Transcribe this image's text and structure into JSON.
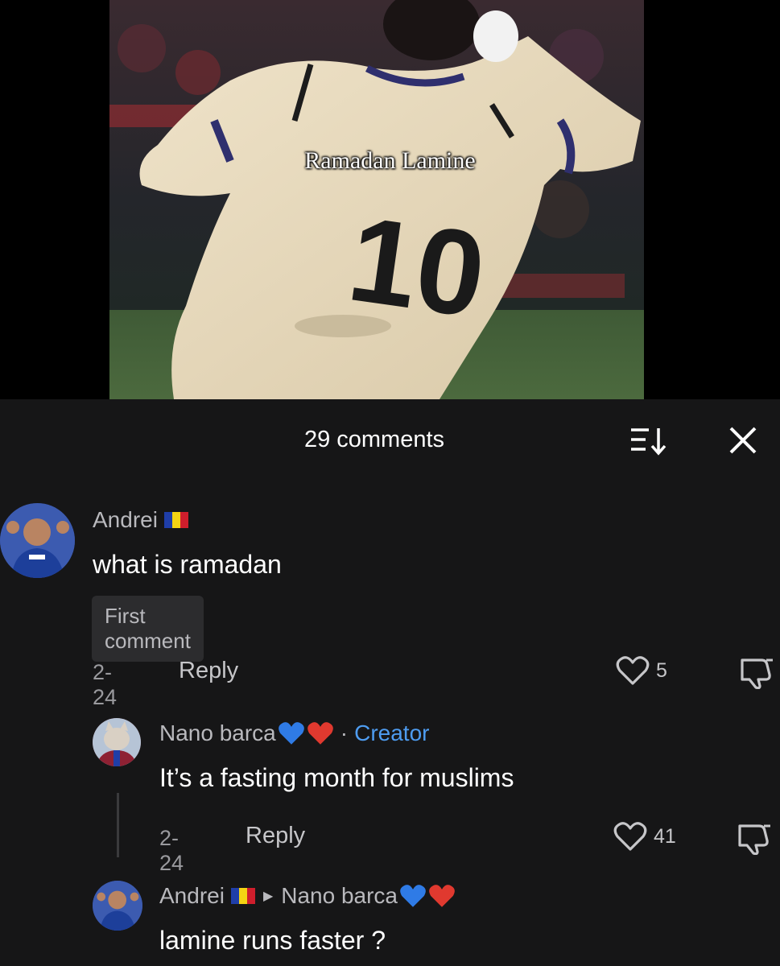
{
  "video": {
    "caption": "Ramadan Lamine",
    "jersey_number": "10"
  },
  "comments_panel": {
    "count_label": "29 comments",
    "sort_icon": "sort-descending-icon",
    "close_icon": "close-icon"
  },
  "comments": [
    {
      "author": "Andrei",
      "flag": "Romania",
      "text": "what is ramadan",
      "badge": "First comment",
      "date": "2-24",
      "reply_label": "Reply",
      "likes": "5"
    },
    {
      "author": "Nano barca",
      "creator_label": "Creator",
      "text": "It’s a fasting month for muslims",
      "date": "2-24",
      "reply_label": "Reply",
      "likes": "41"
    },
    {
      "author": "Andrei",
      "flag": "Romania",
      "reply_to": "Nano barca",
      "text": "lamine runs faster ?"
    }
  ],
  "colors": {
    "background": "#161617",
    "creator_accent": "#4e9cf0",
    "muted_text": "#9a9a9e"
  }
}
